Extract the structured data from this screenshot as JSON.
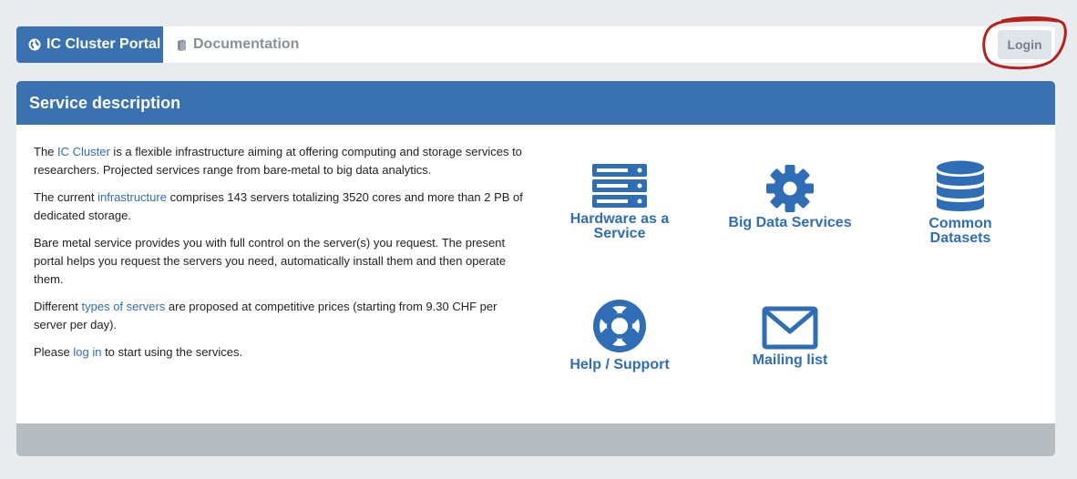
{
  "nav": {
    "brand_label": "IC Cluster Portal",
    "documentation_label": "Documentation",
    "login_label": "Login",
    "brand_color": "#3a71b0",
    "annotation_color": "#b5221e"
  },
  "panel": {
    "title": "Service description",
    "paragraphs": [
      {
        "pre": "The ",
        "link": "IC Cluster",
        "post": " is a flexible infrastructure aiming at offering computing and storage services to researchers. Projected services range from bare-metal to big data analytics."
      },
      {
        "pre": "The current ",
        "link": "infrastructure",
        "post": " comprises 143 servers totalizing 3520 cores and more than 2 PB of dedicated storage."
      },
      {
        "text": "Bare metal service provides you with full control on the server(s) you request. The present portal helps you request the servers you need, automatically install them and then operate them."
      },
      {
        "pre": "Different ",
        "link": "types of servers",
        "post": " are proposed at competitive prices (starting from 9.30 CHF per server per day)."
      },
      {
        "pre": "Please ",
        "link": "log in",
        "post": " to start using the services."
      }
    ]
  },
  "services": [
    {
      "label": "Hardware as a Service",
      "icon": "server-icon"
    },
    {
      "label": "Big Data Services",
      "icon": "gear-icon"
    },
    {
      "label": "Common Datasets",
      "icon": "database-icon"
    },
    {
      "label": "Help / Support",
      "icon": "life-ring-icon"
    },
    {
      "label": "Mailing list",
      "icon": "envelope-icon"
    }
  ]
}
